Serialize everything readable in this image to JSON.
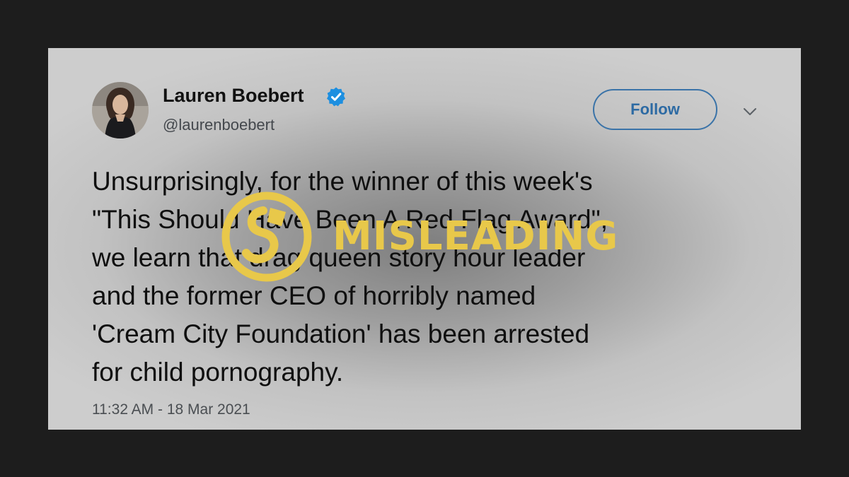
{
  "tweet": {
    "author": {
      "name": "Lauren Boebert",
      "handle": "@laurenboebert",
      "avatar": "profile-photo",
      "verified_icon": "verified-badge-icon"
    },
    "follow_label": "Follow",
    "menu_icon": "chevron-down-icon",
    "text_lines": [
      "Unsurprisingly, for the winner of this week's",
      "\"This Should Have Been A Red Flag Award\",",
      "we learn that drag queen story hour leader",
      "and the former CEO of horribly named",
      "'Cream City Foundation' has been arrested",
      "for child pornography."
    ],
    "timestamp": "11:32 AM - 18 Mar 2021"
  },
  "overlay": {
    "label": "MISLEADING",
    "logo_icon": "snopes-logo-icon"
  },
  "colors": {
    "background": "#1d1d1d",
    "verified_blue": "#1d9bf0",
    "follow_blue": "#2d6aa3",
    "stamp_yellow": "#e8c84a"
  }
}
